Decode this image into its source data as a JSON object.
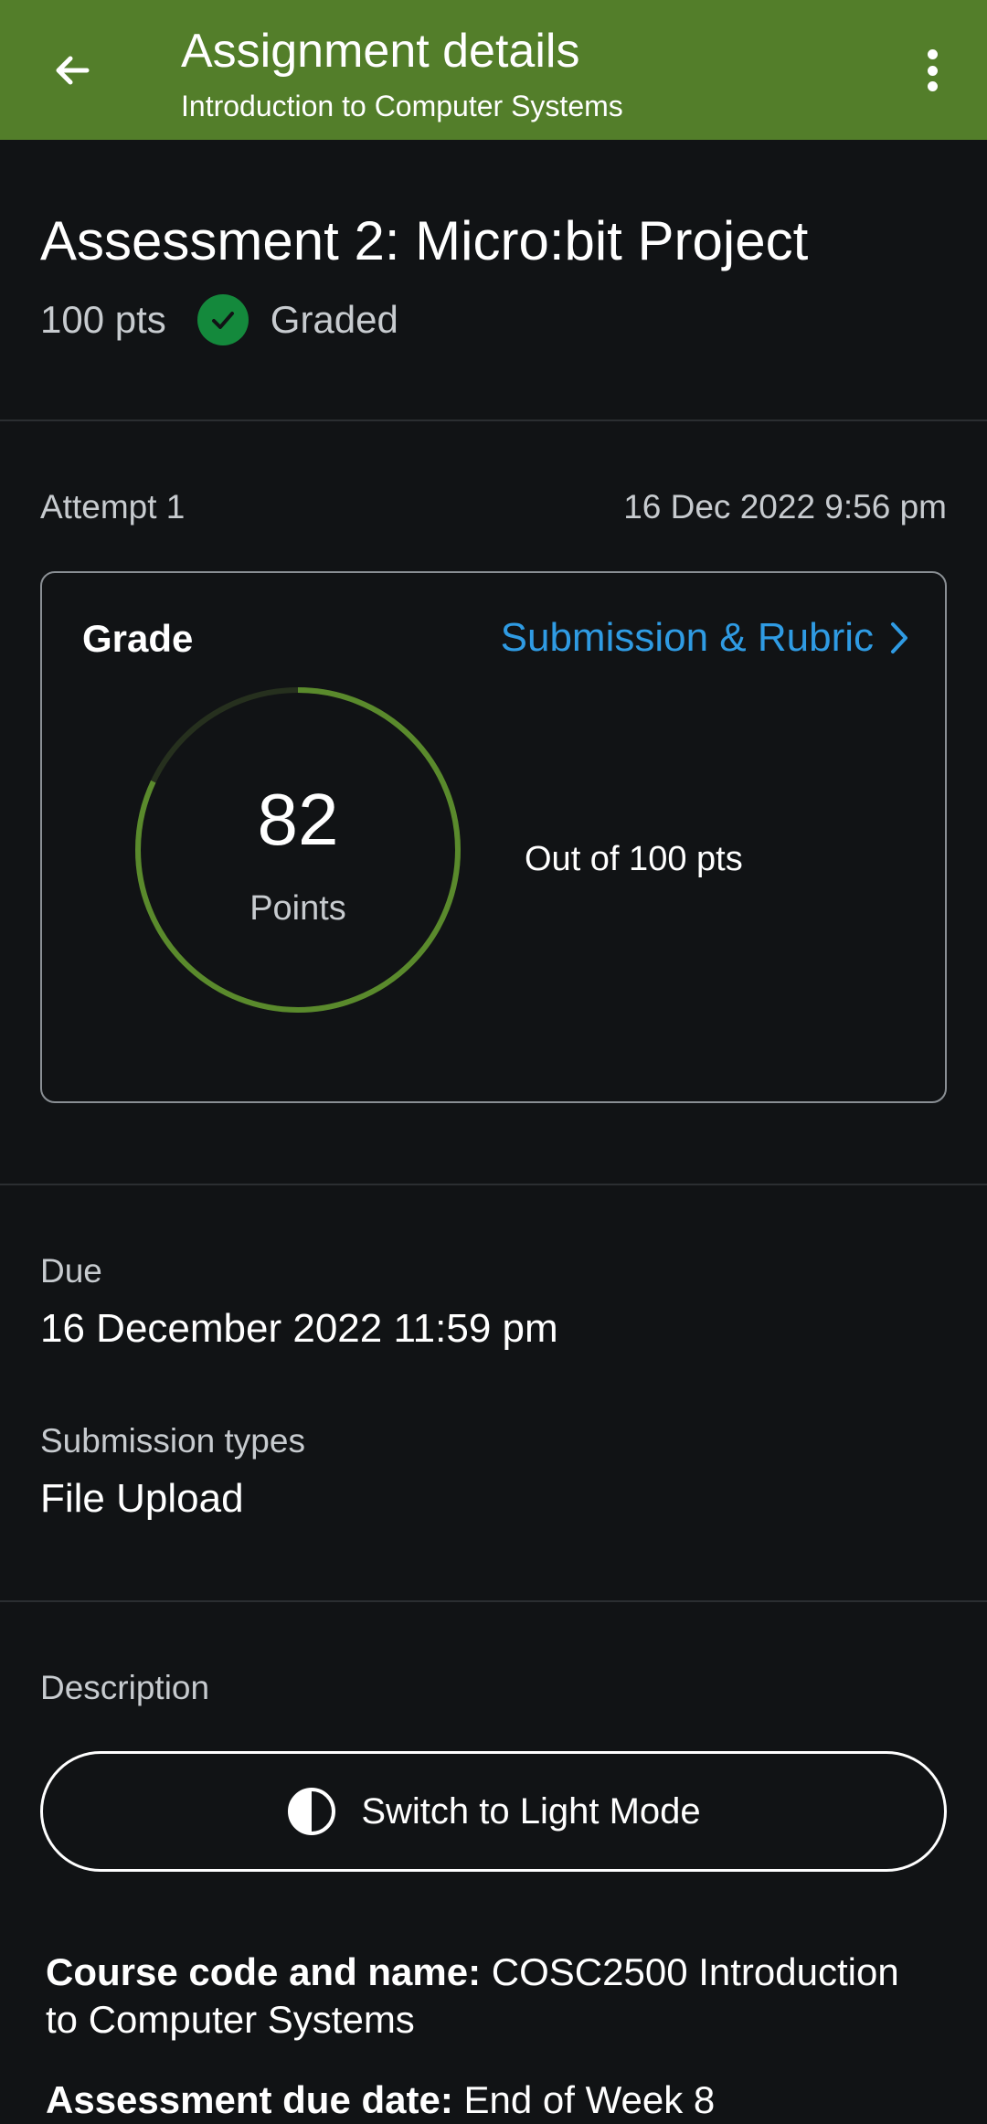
{
  "header": {
    "title": "Assignment details",
    "subtitle": "Introduction to Computer Systems",
    "background_color": "#537e2a"
  },
  "assignment": {
    "title": "Assessment 2: Micro:bit Project",
    "points": "100 pts",
    "status": "Graded",
    "status_color": "#14893c"
  },
  "attempt": {
    "label": "Attempt 1",
    "date": "16 Dec 2022 9:56 pm"
  },
  "grade_card": {
    "label": "Grade",
    "link_label": "Submission & Rubric",
    "score": "82",
    "score_unit": "Points",
    "score_fraction": 0.82,
    "out_of": "Out of 100 pts",
    "ring_color": "#5a8a2c"
  },
  "details": {
    "due_label": "Due",
    "due_value": "16 December 2022 11:59 pm",
    "submission_types_label": "Submission types",
    "submission_types_value": "File Upload",
    "description_label": "Description"
  },
  "mode_button": {
    "label": "Switch to Light Mode"
  },
  "description": {
    "course_label": "Course code and name:",
    "course_value": " COSC2500 Introduction to Computer Systems",
    "line2_label": "Assessment due date:",
    "line2_value": " End of Week 8"
  },
  "icons": {
    "back": "arrow-left-icon",
    "menu": "more-vertical-icon",
    "graded": "check-circle-icon",
    "link": "chevron-right-icon",
    "mode": "contrast-icon"
  }
}
